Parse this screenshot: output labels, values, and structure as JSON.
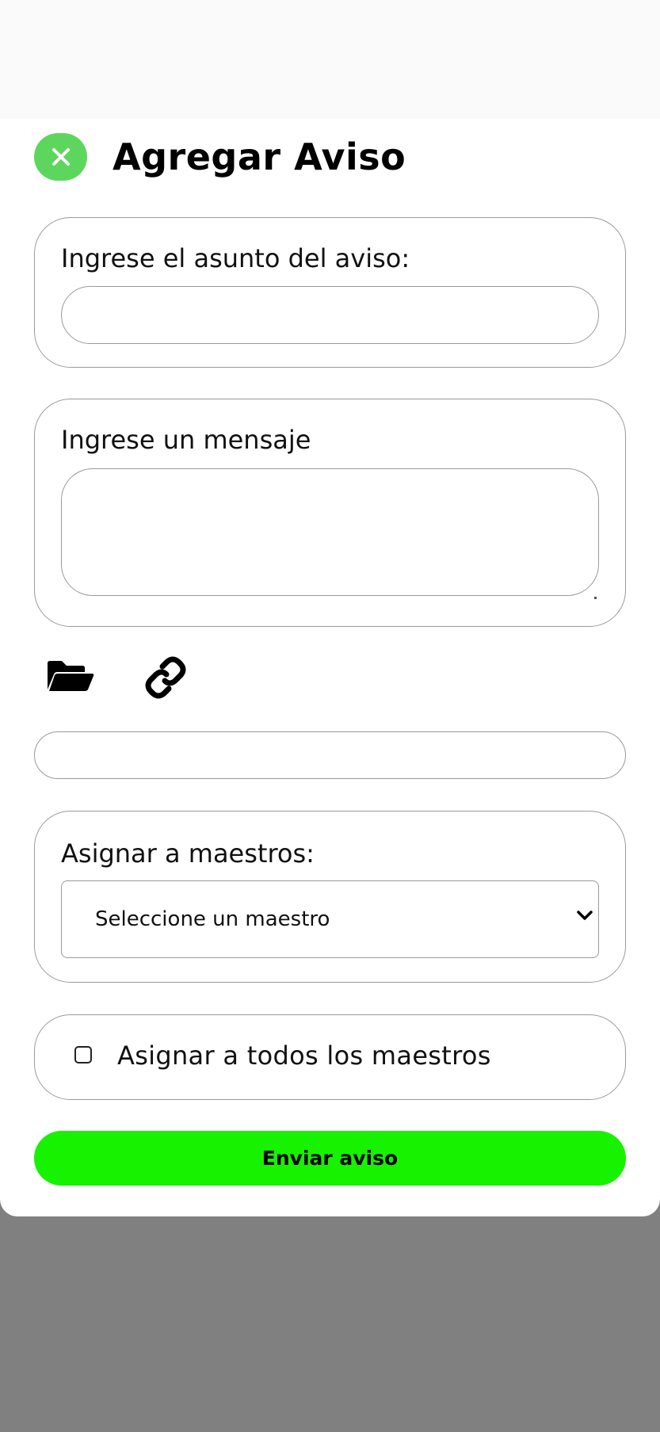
{
  "header": {
    "title": "Agregar Aviso",
    "close_icon": "close-x-icon",
    "close_color": "#5dd65d"
  },
  "subject": {
    "label": "Ingrese el asunto del aviso:",
    "value": ""
  },
  "message": {
    "label": "Ingrese un mensaje",
    "value": ""
  },
  "attachments": {
    "folder_icon": "folder-open-icon",
    "link_icon": "link-icon",
    "url_value": ""
  },
  "assign": {
    "label": "Asignar a maestros:",
    "selected": "Seleccione un maestro",
    "chevron_icon": "chevron-down-icon"
  },
  "assign_all": {
    "label": "Asignar a todos los maestros",
    "checked": false
  },
  "submit": {
    "label": "Enviar aviso",
    "color": "#17f200"
  }
}
